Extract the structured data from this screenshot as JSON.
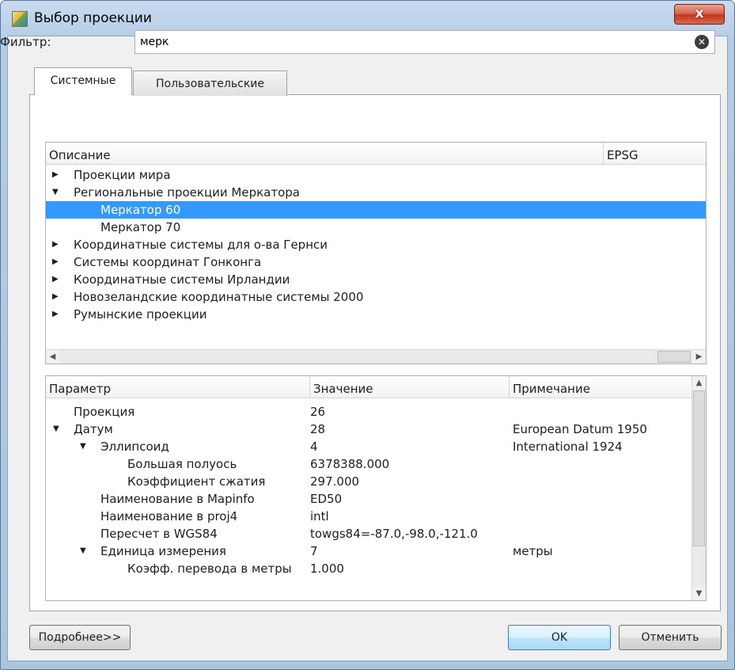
{
  "window": {
    "title": "Выбор проекции",
    "close_glyph": "x"
  },
  "filter": {
    "label": "Фильтр:",
    "value": "мерк",
    "clear_glyph": "✕"
  },
  "tabs": [
    {
      "label": "Системные",
      "active": true
    },
    {
      "label": "Пользовательские",
      "active": false
    }
  ],
  "projection_tree": {
    "headers": [
      "Описание",
      "EPSG"
    ],
    "rows": [
      {
        "label": "Проекции мира",
        "expander": "▶",
        "level": 0
      },
      {
        "label": "Региональные проекции Меркатора",
        "expander": "▼",
        "level": 0
      },
      {
        "label": "Меркатор 60",
        "expander": "",
        "level": 1,
        "selected": true
      },
      {
        "label": "Меркатор 70",
        "expander": "",
        "level": 1
      },
      {
        "label": "Координатные системы для о-ва Гернси",
        "expander": "▶",
        "level": 0
      },
      {
        "label": "Системы координат Гонконга",
        "expander": "▶",
        "level": 0
      },
      {
        "label": "Координатные системы Ирландии",
        "expander": "▶",
        "level": 0
      },
      {
        "label": "Новозеландские координатные системы 2000",
        "expander": "▶",
        "level": 0
      },
      {
        "label": "Румынские проекции",
        "expander": "▶",
        "level": 0
      }
    ],
    "scroll_left_glyph": "◀",
    "scroll_right_glyph": "▶"
  },
  "params_tree": {
    "headers": [
      "Параметр",
      "Значение",
      "Примечание"
    ],
    "rows": [
      {
        "param": "Проекция",
        "value": "26",
        "note": "",
        "expander": "",
        "level": 0
      },
      {
        "param": "Датум",
        "value": "28",
        "note": "European Datum 1950",
        "expander": "▼",
        "level": 0
      },
      {
        "param": "Эллипсоид",
        "value": "4",
        "note": "International 1924",
        "expander": "▼",
        "level": 1
      },
      {
        "param": "Большая полуось",
        "value": "6378388.000",
        "note": "",
        "expander": "",
        "level": 2
      },
      {
        "param": "Коэффициент сжатия",
        "value": "297.000",
        "note": "",
        "expander": "",
        "level": 2
      },
      {
        "param": "Наименование в Mapinfo",
        "value": "ED50",
        "note": "",
        "expander": "",
        "level": 1
      },
      {
        "param": "Наименование в proj4",
        "value": "intl",
        "note": "",
        "expander": "",
        "level": 1
      },
      {
        "param": "Пересчет в WGS84",
        "value": "towgs84=-87.0,-98.0,-121.0",
        "note": "",
        "expander": "",
        "level": 1
      },
      {
        "param": "Единица измерения",
        "value": "7",
        "note": "метры",
        "expander": "▼",
        "level": 1
      },
      {
        "param": "Коэфф. перевода в метры",
        "value": "1.000",
        "note": "",
        "expander": "",
        "level": 2
      }
    ],
    "scroll_up_glyph": "▲",
    "scroll_down_glyph": "▼"
  },
  "buttons": {
    "details": "Подробнее>>",
    "ok": "OK",
    "cancel": "Отменить"
  },
  "colors": {
    "selection": "#3399ff",
    "close_button": "#c2361e",
    "frame": "#aac5e0"
  }
}
